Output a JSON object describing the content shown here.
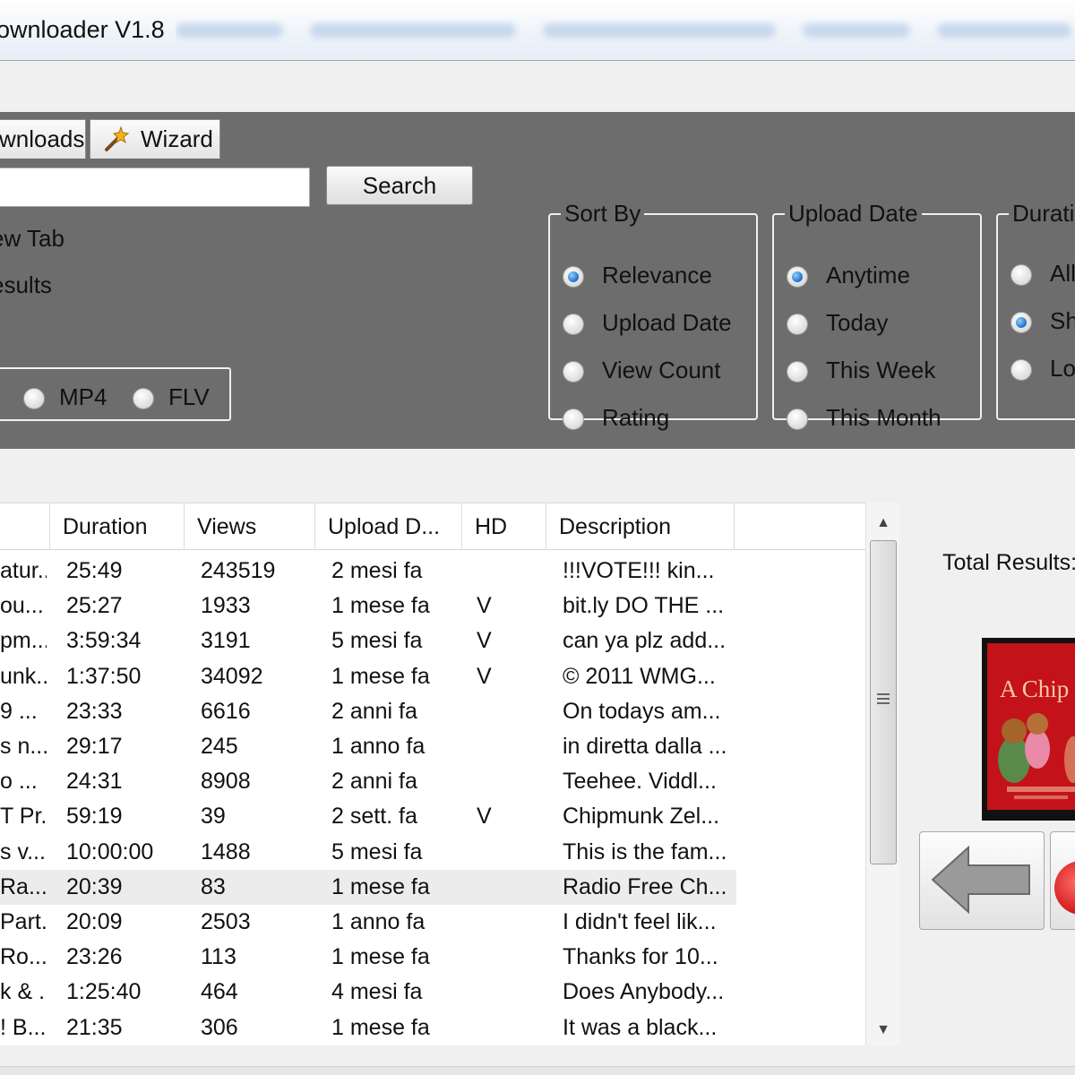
{
  "window": {
    "title": "ownloader V1.8"
  },
  "tabs": [
    {
      "label": "wnloads"
    },
    {
      "label": "Wizard",
      "icon": "wand-icon"
    }
  ],
  "search": {
    "value": "",
    "button_label": "Search",
    "new_tab_label": "ew Tab",
    "results_label": "esults"
  },
  "format": {
    "options": [
      {
        "label": "MP4",
        "selected": false
      },
      {
        "label": "FLV",
        "selected": false
      }
    ]
  },
  "sort_by": {
    "legend": "Sort By",
    "options": [
      {
        "label": "Relevance",
        "selected": true
      },
      {
        "label": "Upload Date",
        "selected": false
      },
      {
        "label": "View Count",
        "selected": false
      },
      {
        "label": "Rating",
        "selected": false
      }
    ]
  },
  "upload_date": {
    "legend": "Upload Date",
    "options": [
      {
        "label": "Anytime",
        "selected": true
      },
      {
        "label": "Today",
        "selected": false
      },
      {
        "label": "This Week",
        "selected": false
      },
      {
        "label": "This Month",
        "selected": false
      }
    ]
  },
  "duration": {
    "legend": "Duratio",
    "options": [
      {
        "label": "All",
        "selected": false
      },
      {
        "label": "Sh",
        "selected": true
      },
      {
        "label": "Lo",
        "selected": false
      }
    ]
  },
  "table": {
    "columns": [
      "Duration",
      "Views",
      "Upload D...",
      "HD",
      "Description"
    ],
    "rows": [
      {
        "title": "atur...",
        "duration": "25:49",
        "views": "243519",
        "uploaded": "2 mesi fa",
        "hd": "",
        "description": "!!!VOTE!!! kin..."
      },
      {
        "title": "ou...",
        "duration": "25:27",
        "views": "1933",
        "uploaded": "1 mese fa",
        "hd": "V",
        "description": "bit.ly DO THE ..."
      },
      {
        "title": "pm...",
        "duration": "3:59:34",
        "views": "3191",
        "uploaded": "5 mesi fa",
        "hd": "V",
        "description": "can ya plz add..."
      },
      {
        "title": "unk...",
        "duration": "1:37:50",
        "views": "34092",
        "uploaded": "1 mese fa",
        "hd": "V",
        "description": "© 2011 WMG..."
      },
      {
        "title": "9 ...",
        "duration": "23:33",
        "views": "6616",
        "uploaded": "2 anni fa",
        "hd": "",
        "description": "On todays am..."
      },
      {
        "title": "s n...",
        "duration": "29:17",
        "views": "245",
        "uploaded": "1 anno fa",
        "hd": "",
        "description": "in diretta dalla ..."
      },
      {
        "title": "o ...",
        "duration": "24:31",
        "views": "8908",
        "uploaded": "2 anni fa",
        "hd": "",
        "description": "Teehee. Viddl..."
      },
      {
        "title": "T Pr...",
        "duration": "59:19",
        "views": "39",
        "uploaded": "2 sett. fa",
        "hd": "V",
        "description": "Chipmunk Zel..."
      },
      {
        "title": "s v...",
        "duration": "10:00:00",
        "views": "1488",
        "uploaded": "5 mesi fa",
        "hd": "",
        "description": "This is the fam..."
      },
      {
        "title": "Ra...",
        "duration": "20:39",
        "views": "83",
        "uploaded": "1 mese fa",
        "hd": "",
        "description": "Radio Free Ch...",
        "selected": true
      },
      {
        "title": "Part...",
        "duration": "20:09",
        "views": "2503",
        "uploaded": "1 anno fa",
        "hd": "",
        "description": "I didn't feel lik..."
      },
      {
        "title": "Ro...",
        "duration": "23:26",
        "views": "113",
        "uploaded": "1 mese fa",
        "hd": "",
        "description": "Thanks for 10..."
      },
      {
        "title": "k & ...",
        "duration": "1:25:40",
        "views": "464",
        "uploaded": "4 mesi fa",
        "hd": "",
        "description": "Does Anybody..."
      },
      {
        "title": "! B...",
        "duration": "21:35",
        "views": "306",
        "uploaded": "1 mese fa",
        "hd": "",
        "description": "It was a black..."
      }
    ]
  },
  "results": {
    "total_label": "Total Results:"
  },
  "preview": {
    "thumbnail_text": "A Chip"
  },
  "nav": {
    "back_icon": "left-arrow-icon",
    "next_icon": "red-circle-icon"
  },
  "colors": {
    "panel": "#6d6d6d",
    "accent_radio": "#1f6fc7",
    "thumbnail": "#c4121a"
  }
}
